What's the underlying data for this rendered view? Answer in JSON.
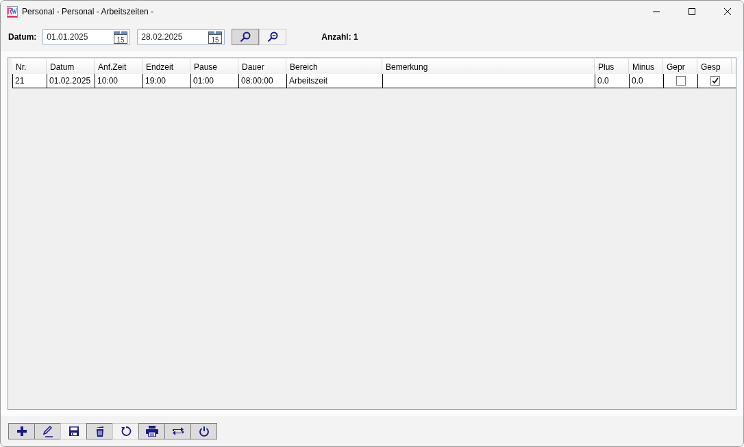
{
  "window": {
    "title": "Personal - Personal - Arbeitszeiten -"
  },
  "filter": {
    "label": "Datum:",
    "from": "01.01.2025",
    "from_calendar_day": "15",
    "to": "28.02.2025",
    "to_calendar_day": "15",
    "count": "Anzahl: 1"
  },
  "search_buttons": [
    {
      "kind": "search",
      "selected": true
    },
    {
      "kind": "zoom-out",
      "selected": false
    }
  ],
  "table": {
    "columns": [
      {
        "label": "Nr.",
        "kind": "text"
      },
      {
        "label": "Datum",
        "kind": "text"
      },
      {
        "label": "Anf.Zeit",
        "kind": "text"
      },
      {
        "label": "Endzeit",
        "kind": "text"
      },
      {
        "label": "Pause",
        "kind": "text"
      },
      {
        "label": "Dauer",
        "kind": "text"
      },
      {
        "label": "Bereich",
        "kind": "text"
      },
      {
        "label": "Bemerkung",
        "kind": "text"
      },
      {
        "label": "Plus",
        "kind": "text"
      },
      {
        "label": "Minus",
        "kind": "text"
      },
      {
        "label": "Gepr",
        "kind": "check"
      },
      {
        "label": "Gesp",
        "kind": "check"
      }
    ],
    "rows": [
      {
        "cells": [
          "21",
          "01.02.2025",
          "10:00",
          "19:00",
          "01:00",
          "08:00:00",
          "Arbeitszeit",
          "",
          "0.0",
          "0.0"
        ],
        "checks": [
          {
            "checked": false
          },
          {
            "checked": true
          }
        ]
      }
    ]
  },
  "toolbar": [
    {
      "kind": "add",
      "flat": false
    },
    {
      "kind": "edit",
      "flat": false
    },
    {
      "kind": "save",
      "flat": true
    },
    {
      "kind": "delete",
      "flat": false
    },
    {
      "kind": "refresh",
      "flat": true
    },
    {
      "kind": "print",
      "flat": false
    },
    {
      "kind": "swap",
      "flat": false
    },
    {
      "kind": "power",
      "flat": false
    }
  ]
}
